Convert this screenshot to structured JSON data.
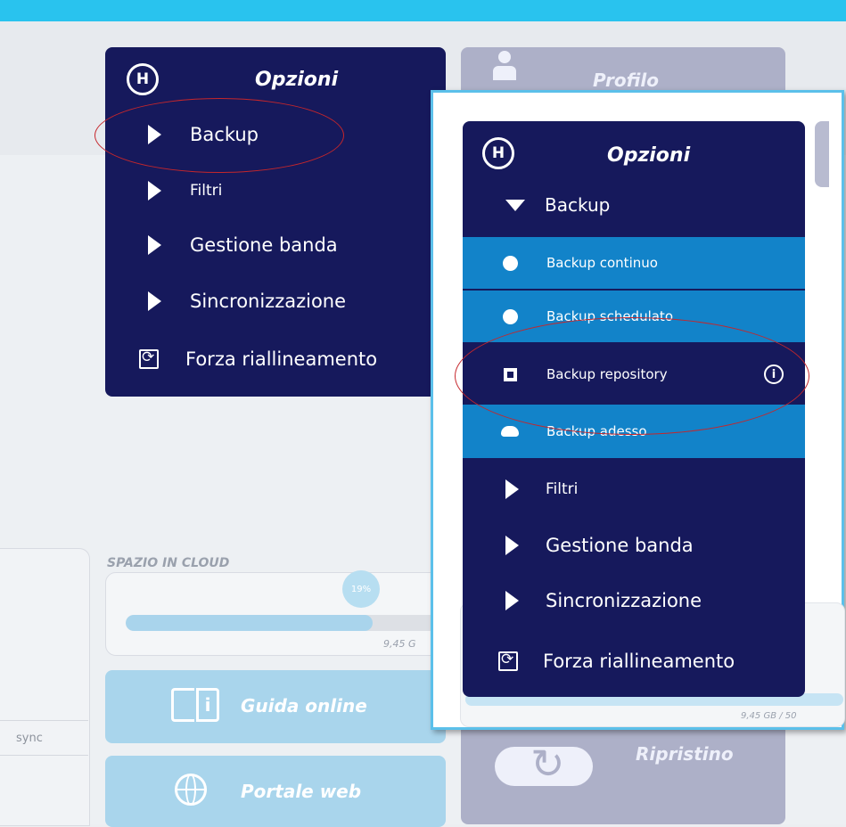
{
  "colors": {
    "navy": "#16195c",
    "accent_blue": "#1283c9",
    "top_bar": "#29c3ee",
    "annotation_red": "#c5262b"
  },
  "options_panel": {
    "logo_icon": "hotmirror-logo-icon",
    "title": "Opzioni",
    "items": [
      {
        "label": "Backup",
        "icon": "triangle-right-icon"
      },
      {
        "label": "Filtri",
        "icon": "triangle-right-icon"
      },
      {
        "label": "Gestione banda",
        "icon": "triangle-right-icon"
      },
      {
        "label": "Sincronizzazione",
        "icon": "triangle-right-icon"
      },
      {
        "label": "Forza riallineamento",
        "icon": "sync-icon"
      }
    ]
  },
  "profilo_card": {
    "label": "Profilo",
    "icon": "person-icon"
  },
  "dashboard": {
    "sync_text": "sync",
    "cloud_space_label": "SPAZIO IN CLOUD",
    "cloud_usage_percent": "19%",
    "cloud_usage_fraction": 0.19,
    "cloud_size_text": "9,45 G",
    "guida_label": "Guida online",
    "portale_label": "Portale web",
    "ripristino_label": "Ripristino"
  },
  "zoom_popup": {
    "title": "Opzioni",
    "backup_label": "Backup",
    "backup_sub": [
      {
        "label": "Backup continuo",
        "icon": "radio-filled-icon"
      },
      {
        "label": "Backup schedulato",
        "icon": "radio-filled-icon"
      },
      {
        "label": "Backup repository",
        "icon": "checkbox-icon",
        "info_icon": "info-icon"
      },
      {
        "label": "Backup adesso",
        "icon": "cloud-upload-icon"
      }
    ],
    "items": [
      {
        "label": "Filtri"
      },
      {
        "label": "Gestione banda"
      },
      {
        "label": "Sincronizzazione"
      },
      {
        "label": "Forza riallineamento"
      }
    ],
    "size_text": "9,45 GB / 50"
  }
}
